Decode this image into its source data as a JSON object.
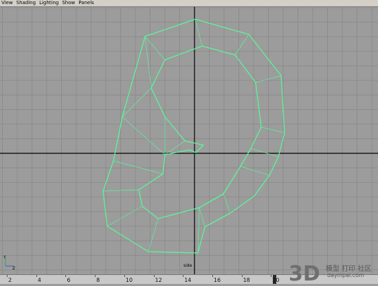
{
  "menubar": {
    "items": [
      {
        "label": "View"
      },
      {
        "label": "Shading"
      },
      {
        "label": "Lighting"
      },
      {
        "label": "Show"
      },
      {
        "label": "Panels"
      }
    ]
  },
  "viewport": {
    "camera_label": "side",
    "grid_color": "#888888",
    "axis_color": "#000000",
    "wire_color": "#5cf59a"
  },
  "axis_gizmo": {
    "y_label": "Y",
    "z_label": "Z"
  },
  "timeline": {
    "ticks": [
      "2",
      "4",
      "6",
      "8",
      "10",
      "12",
      "14",
      "16",
      "18",
      "20"
    ]
  },
  "watermark": {
    "cn_text": "模型 打印 社区",
    "url_text": "dayinpai.com"
  }
}
